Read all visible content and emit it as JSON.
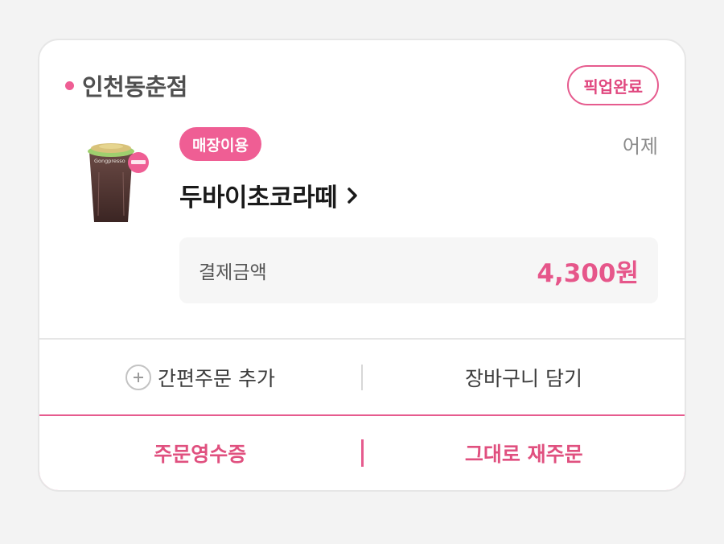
{
  "order": {
    "store_name": "인천동춘점",
    "status": "픽업완료",
    "service_type": "매장이용",
    "date": "어제",
    "product_name": "두바이초코라떼",
    "payment_label": "결제금액",
    "payment_amount": "4,300원"
  },
  "actions": {
    "quick_order": "간편주문 추가",
    "add_cart": "장바구니 담기",
    "receipt": "주문영수증",
    "reorder": "그대로 재주문"
  },
  "product_cup_text": "Gongpresso",
  "colors": {
    "accent": "#e65b8e",
    "accent_fill": "#ef5e94",
    "background": "#f3f3f3",
    "card": "#ffffff"
  },
  "icons": [
    "product-image",
    "chevron-right-icon",
    "plus-circle-icon"
  ]
}
